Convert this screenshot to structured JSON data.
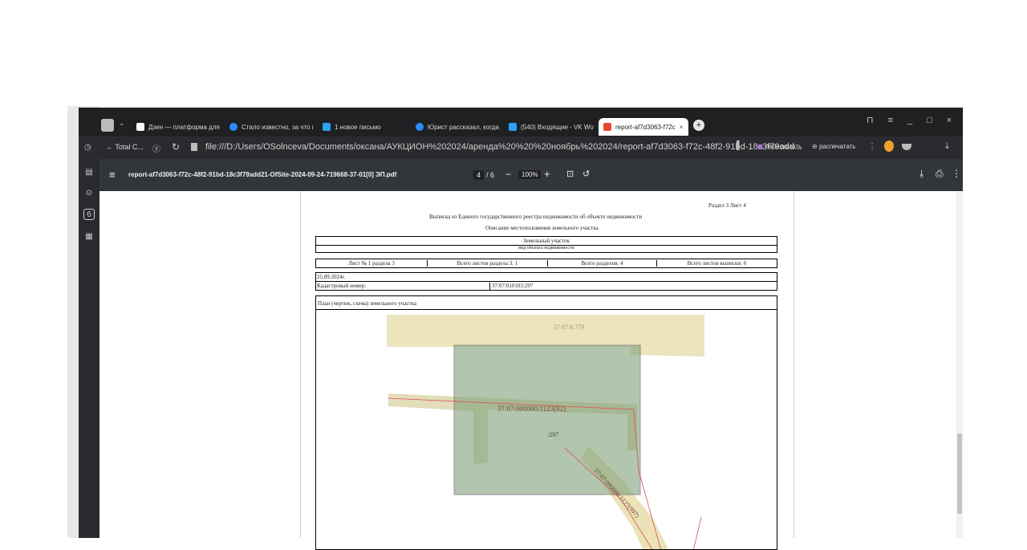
{
  "tabs": [
    {
      "label": "Дзен — платформа для п",
      "icon": "dzen-icon",
      "color": "#ffffff"
    },
    {
      "label": "Стало известно, за что п",
      "icon": "news-icon",
      "color": "#2b8cff"
    },
    {
      "label": "1 новое письмо",
      "icon": "mail-icon",
      "color": "#2aa3f4"
    },
    {
      "label": "Юрист рассказал, когда б",
      "icon": "news-icon",
      "color": "#2b8cff"
    },
    {
      "label": "(540) Входящие - VK Wor",
      "icon": "mail-icon",
      "color": "#2aa3f4"
    },
    {
      "label": "report-af7d3063-f72c",
      "icon": "pdf-icon",
      "color": "#e5482f",
      "active": true
    }
  ],
  "address": {
    "back_label": "← Total C...",
    "url": "file:///D:/Users/OSolnceva/Documents/оксана/АУКЦИОН%202024/аренда%20%20%20ноябрь%202024/report-af7d3063-f72c-48f2-91bd-18c3f79add...",
    "retell_label": "пересказать",
    "print_label": "распечатать"
  },
  "pdf": {
    "filename": "report-af7d3063-f72c-48f2-91bd-18c3f79add21-OfSite-2024-09-24-719668-37-01[0] ЭП.pdf",
    "page_current": "4",
    "page_total": "/ 6",
    "zoom": "100%"
  },
  "doc": {
    "section": "Раздел 3   Лист 4",
    "title": "Выписка из Единого государственного реестра недвижимости об объекте недвижимости",
    "subtitle": "Описание местоположения земельного участка",
    "object_type": "Земельный участок",
    "object_caption": "вид объекта недвижимости",
    "sheet_no": "Лист № 1 раздела 3",
    "sheets_in_section": "Всего листов раздела 3: 1",
    "sections_total": "Всего разделов: 4",
    "sheets_total": "Всего листов выписки: 6",
    "date": "25.09.2024г.",
    "cadastral_label": "Кадастровый номер:",
    "cadastral_value": "37:07:010103:297",
    "plan_title": "План (чертеж, схема) земельного участка",
    "map_label_top": "37:07:6.779",
    "map_label_road": "37:07:000000:1123(82)",
    "map_label_parcel": ":297",
    "map_label_diag": "37:07:000000:1127(997)"
  }
}
